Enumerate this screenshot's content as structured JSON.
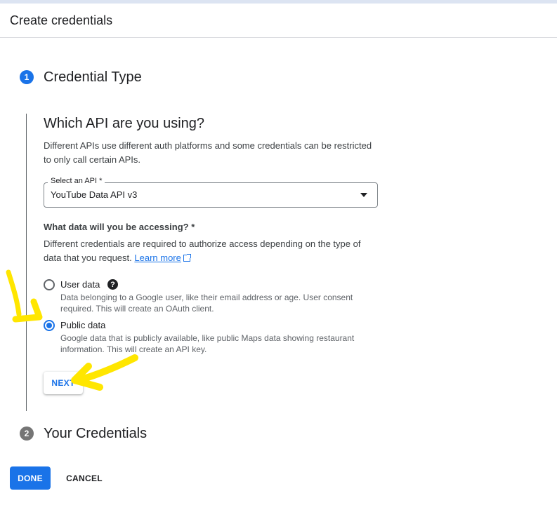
{
  "header": {
    "title": "Create credentials"
  },
  "steps": [
    {
      "number": "1",
      "title": "Credential Type"
    },
    {
      "number": "2",
      "title": "Your Credentials"
    }
  ],
  "section": {
    "heading": "Which API are you using?",
    "description": "Different APIs use different auth platforms and some credentials can be restricted to only call certain APIs."
  },
  "api_select": {
    "label": "Select an API *",
    "value": "YouTube Data API v3"
  },
  "data_question": {
    "label": "What data will you be accessing? *",
    "description": "Different credentials are required to authorize access depending on the type of data that you request.",
    "link": "Learn more"
  },
  "options": [
    {
      "label": "User data",
      "description": "Data belonging to a Google user, like their email address or age. User consent required. This will create an OAuth client.",
      "selected": false
    },
    {
      "label": "Public data",
      "description": "Google data that is publicly available, like public Maps data showing restaurant information. This will create an API key.",
      "selected": true
    }
  ],
  "help_icon": "help-circle-icon",
  "buttons": {
    "next": "NEXT",
    "done": "DONE",
    "cancel": "CANCEL"
  },
  "colors": {
    "accent": "#1a73e8",
    "annotation": "#ffe600"
  }
}
